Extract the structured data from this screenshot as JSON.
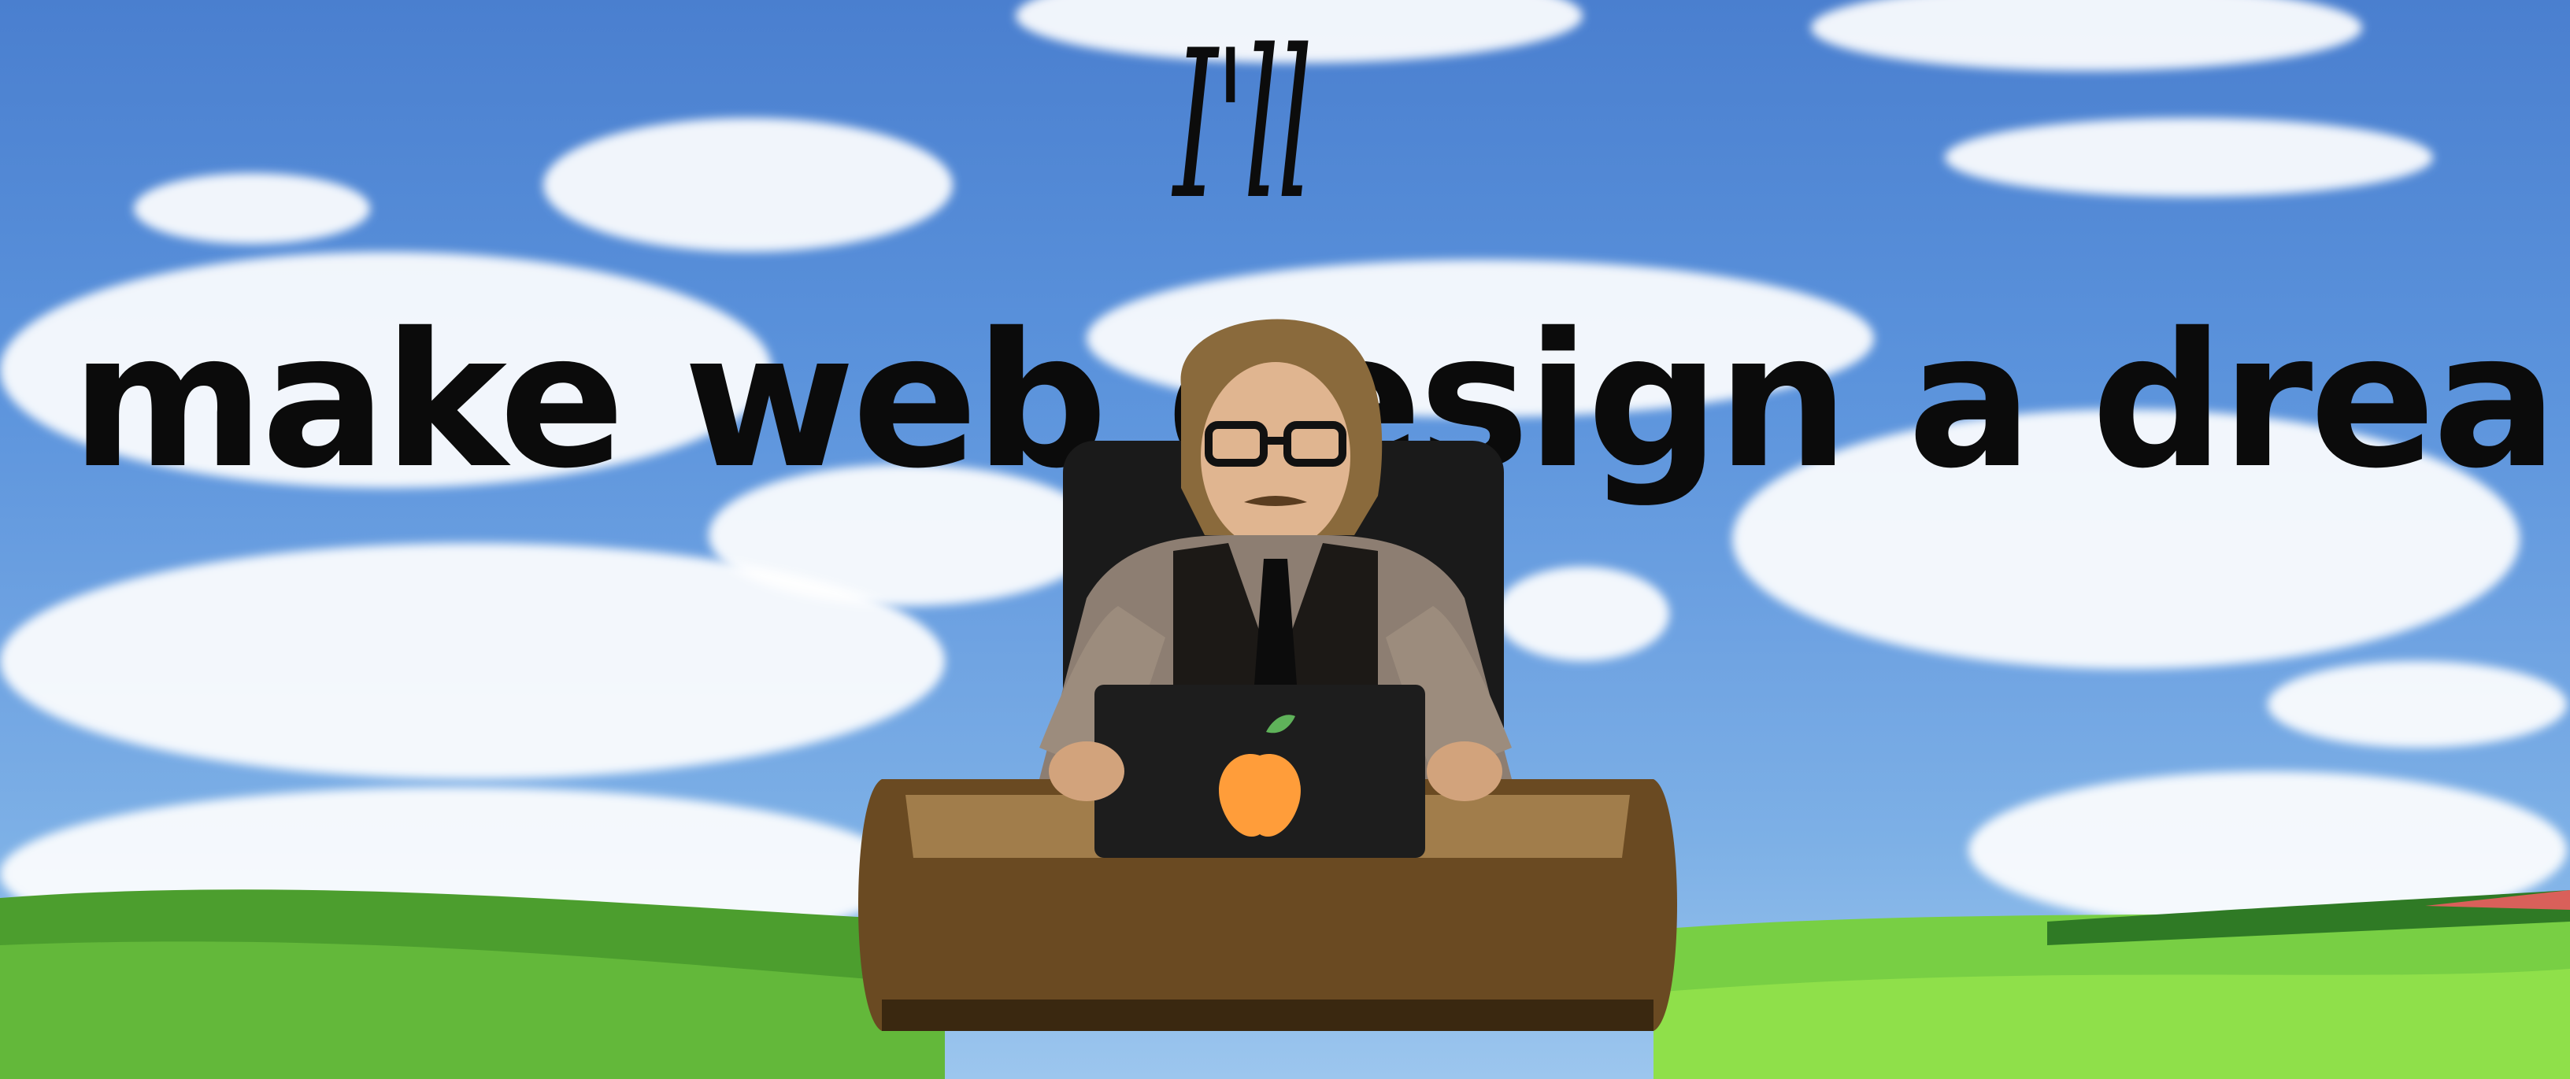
{
  "headline": {
    "top": "I'll",
    "main": "make web design a dream"
  },
  "colors": {
    "sky_top": "#4a7fcf",
    "sky_bottom": "#9cc6ee",
    "grass_light": "#7fd14a",
    "grass_dark": "#3d8f26",
    "text": "#0b0b0b"
  },
  "scene": {
    "subject": "person-at-desk",
    "laptop_logo": "apple-icon"
  }
}
